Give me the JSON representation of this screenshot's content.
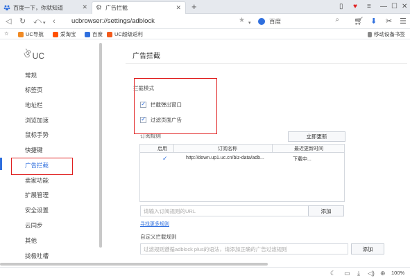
{
  "tabs": [
    {
      "title": "百度一下，你就知道",
      "active": false
    },
    {
      "title": "广告拦截",
      "active": true
    }
  ],
  "address_bar": {
    "url": "ucbrowser://settings/adblock",
    "search_engine": "百度"
  },
  "bookmarks": [
    {
      "label": "UC导航",
      "icon": "uc-icon"
    },
    {
      "label": "爱淘宝",
      "icon": "taobao-icon"
    },
    {
      "label": "百度",
      "icon": "baidu-icon"
    },
    {
      "label": "UC超级返利",
      "icon": "rebate-icon"
    }
  ],
  "bookmarks_right": "移动设备书签",
  "sidebar": {
    "logo": "UC",
    "items": [
      {
        "label": "常规"
      },
      {
        "label": "标签页"
      },
      {
        "label": "地址栏"
      },
      {
        "label": "浏览加速"
      },
      {
        "label": "鼠标手势"
      },
      {
        "label": "快捷键"
      },
      {
        "label": "广告拦截",
        "active": true
      },
      {
        "label": "卖家功能"
      },
      {
        "label": "扩展管理"
      },
      {
        "label": "安全设置"
      },
      {
        "label": "云同步"
      },
      {
        "label": "其他"
      },
      {
        "label": "拢极吐槽"
      }
    ]
  },
  "main": {
    "title": "广告拦截",
    "block_mode": {
      "heading": "拦截模式",
      "options": [
        {
          "label": "拦截弹出窗口",
          "checked": true
        },
        {
          "label": "过滤页面广告",
          "checked": true
        }
      ]
    },
    "subscription": {
      "heading": "订阅规则",
      "update_button": "立即更新",
      "columns": [
        "启用",
        "订阅名称",
        "最近更新时间"
      ],
      "rows": [
        {
          "enabled": true,
          "name": "http://down.up1.uc.cn/biz-data/adb...",
          "updated": "下载中..."
        }
      ],
      "input_placeholder": "请输入订阅规则的URL",
      "add_button": "添加",
      "more_link": "寻找更多规则"
    },
    "custom": {
      "heading": "自定义拦截规则",
      "input_placeholder": "过滤规则遵循adblock plus的语法，请添加正确的广告过滤规则",
      "add_button": "添加"
    }
  },
  "status": {
    "zoom": "100%"
  },
  "colors": {
    "accent": "#2f6fde",
    "highlight": "#e02020"
  }
}
